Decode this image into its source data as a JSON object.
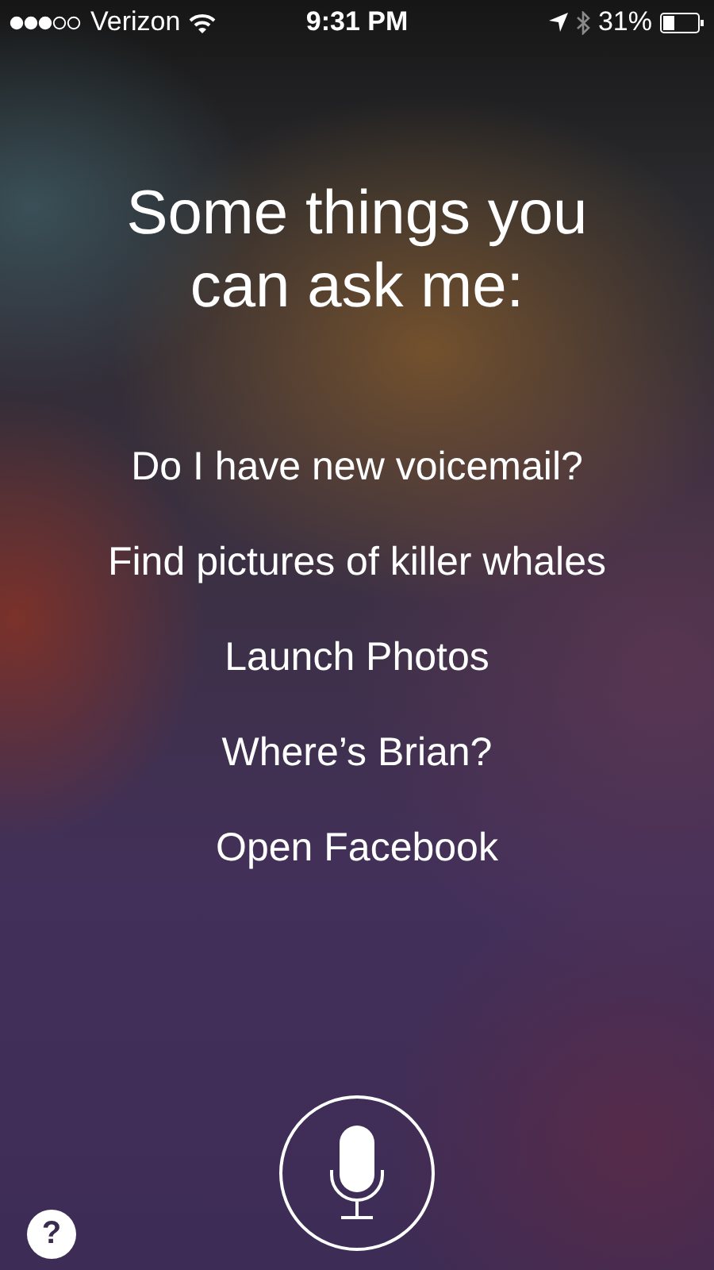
{
  "status_bar": {
    "carrier": "Verizon",
    "time": "9:31 PM",
    "battery_percent": "31%",
    "bluetooth_on": false
  },
  "heading": "Some things you can ask me:",
  "suggestions": [
    "Do I have new voicemail?",
    "Find pictures of killer whales",
    "Launch Photos",
    "Where’s Brian?",
    "Open Facebook"
  ],
  "help_button": "?"
}
